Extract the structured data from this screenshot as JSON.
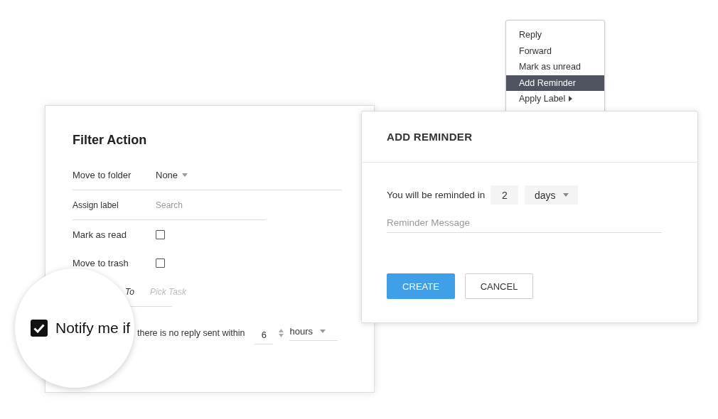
{
  "filter_action": {
    "title": "Filter Action",
    "rows": [
      {
        "kind": "dropdown",
        "label": "Move to folder",
        "value": "None"
      },
      {
        "kind": "search",
        "label": "Assign label",
        "placeholder": "Search"
      },
      {
        "kind": "checkbox",
        "label": "Mark as read",
        "checked": false
      },
      {
        "kind": "checkbox",
        "label": "Move to trash",
        "checked": false
      },
      {
        "kind": "task",
        "label": "To",
        "placeholder": "Pick Task"
      }
    ],
    "notify": {
      "checked": true,
      "label": "Notify me if",
      "text": "there is no reply sent within",
      "amount": "6",
      "unit": "hours"
    }
  },
  "context_menu": {
    "items": [
      {
        "label": "Reply",
        "selected": false,
        "submenu": false
      },
      {
        "label": "Forward",
        "selected": false,
        "submenu": false
      },
      {
        "label": "Mark as unread",
        "selected": false,
        "submenu": false
      },
      {
        "label": "Add Reminder",
        "selected": true,
        "submenu": false
      },
      {
        "label": "Apply Label",
        "selected": false,
        "submenu": true
      }
    ]
  },
  "add_reminder": {
    "title": "ADD REMINDER",
    "prompt": "You will be reminded in",
    "amount": "2",
    "unit": "days",
    "message_placeholder": "Reminder Message",
    "buttons": [
      {
        "label": "CREATE",
        "kind": "primary"
      },
      {
        "label": "CANCEL",
        "kind": "secondary"
      }
    ]
  }
}
